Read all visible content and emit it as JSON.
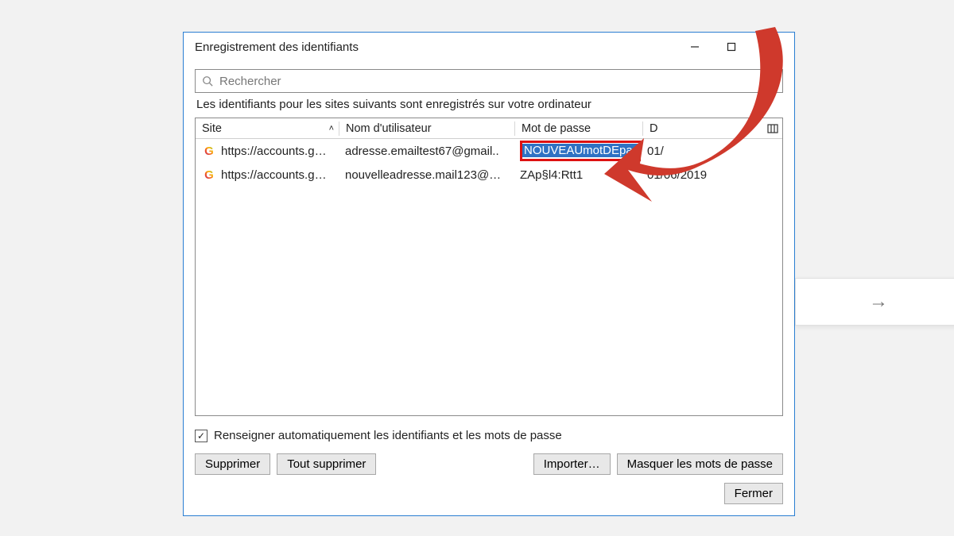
{
  "dialog": {
    "title": "Enregistrement des identifiants"
  },
  "search": {
    "placeholder": "Rechercher"
  },
  "description": "Les identifiants pour les sites suivants sont enregistrés sur votre ordinateur",
  "columns": {
    "site": "Site",
    "user": "Nom d'utilisateur",
    "pass": "Mot de passe",
    "date_prefix": "D"
  },
  "rows": [
    {
      "site": "https://accounts.g…",
      "user": "adresse.emailtest67@gmail..",
      "pass": "NOUVEAUmotDEpas",
      "date": "01/"
    },
    {
      "site": "https://accounts.g…",
      "user": "nouvelleadresse.mail123@…",
      "pass": "ZAp§l4:Rtt1",
      "date": "01/06/2019"
    }
  ],
  "autofill_label": "Renseigner automatiquement les identifiants et les mots de passe",
  "buttons": {
    "delete": "Supprimer",
    "delete_all": "Tout supprimer",
    "import": "Importer…",
    "mask": "Masquer les mots de passe",
    "close": "Fermer"
  },
  "nav_arrow": "→"
}
